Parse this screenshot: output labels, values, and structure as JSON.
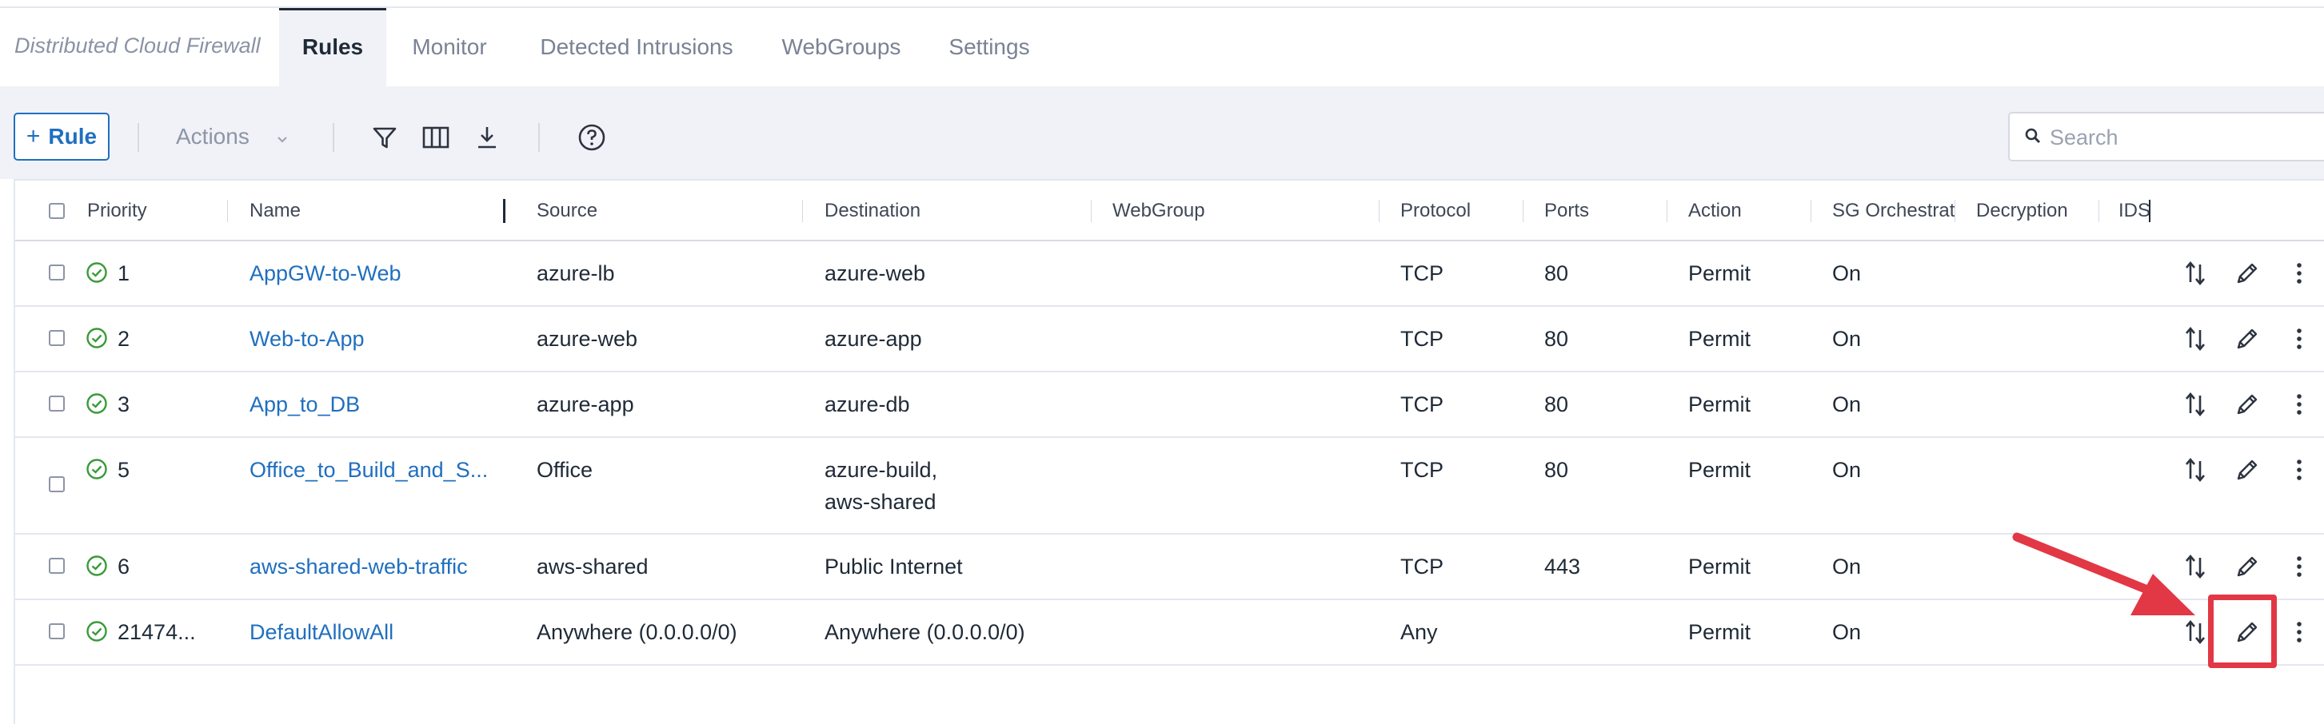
{
  "app": {
    "title": "Distributed Cloud Firewall"
  },
  "tabs": [
    {
      "label": "Rules",
      "active": true
    },
    {
      "label": "Monitor",
      "active": false
    },
    {
      "label": "Detected Intrusions",
      "active": false
    },
    {
      "label": "WebGroups",
      "active": false
    },
    {
      "label": "Settings",
      "active": false
    }
  ],
  "toolbar": {
    "add_rule_label": "Rule",
    "add_rule_icon": "plus-icon",
    "actions_label": "Actions",
    "icons": [
      "filter-icon",
      "columns-icon",
      "download-icon",
      "help-icon"
    ],
    "search_placeholder": "Search"
  },
  "table": {
    "columns": [
      "Priority",
      "Name",
      "Source",
      "Destination",
      "WebGroup",
      "Protocol",
      "Ports",
      "Action",
      "SG Orchestrat",
      "Decryption",
      "IDS"
    ],
    "rows": [
      {
        "priority": "1",
        "name": "AppGW-to-Web",
        "source": "azure-lb",
        "destination": "azure-web",
        "webgroup": "",
        "protocol": "TCP",
        "ports": "80",
        "action": "Permit",
        "sg_orchestration": "On",
        "decryption": "",
        "ids": ""
      },
      {
        "priority": "2",
        "name": "Web-to-App",
        "source": "azure-web",
        "destination": "azure-app",
        "webgroup": "",
        "protocol": "TCP",
        "ports": "80",
        "action": "Permit",
        "sg_orchestration": "On",
        "decryption": "",
        "ids": ""
      },
      {
        "priority": "3",
        "name": "App_to_DB",
        "source": "azure-app",
        "destination": "azure-db",
        "webgroup": "",
        "protocol": "TCP",
        "ports": "80",
        "action": "Permit",
        "sg_orchestration": "On",
        "decryption": "",
        "ids": ""
      },
      {
        "priority": "5",
        "name": "Office_to_Build_and_S...",
        "source": "Office",
        "destination": "azure-build,\naws-shared",
        "webgroup": "",
        "protocol": "TCP",
        "ports": "80",
        "action": "Permit",
        "sg_orchestration": "On",
        "decryption": "",
        "ids": ""
      },
      {
        "priority": "6",
        "name": "aws-shared-web-traffic",
        "source": "aws-shared",
        "destination": "Public Internet",
        "webgroup": "",
        "protocol": "TCP",
        "ports": "443",
        "action": "Permit",
        "sg_orchestration": "On",
        "decryption": "",
        "ids": ""
      },
      {
        "priority": "21474...",
        "name": "DefaultAllowAll",
        "source": "Anywhere (0.0.0.0/0)",
        "destination": "Anywhere (0.0.0.0/0)",
        "webgroup": "",
        "protocol": "Any",
        "ports": "",
        "action": "Permit",
        "sg_orchestration": "On",
        "decryption": "",
        "ids": ""
      }
    ],
    "row_icons": [
      "status-check-icon",
      "reorder-icon",
      "edit-pencil-icon",
      "more-vertical-icon"
    ]
  },
  "annotation": {
    "color": "#e23744",
    "target": "edit-pencil-icon"
  },
  "colors": {
    "accent": "#1f6fbf",
    "success": "#3a9a3a",
    "annotation": "#e23744"
  }
}
